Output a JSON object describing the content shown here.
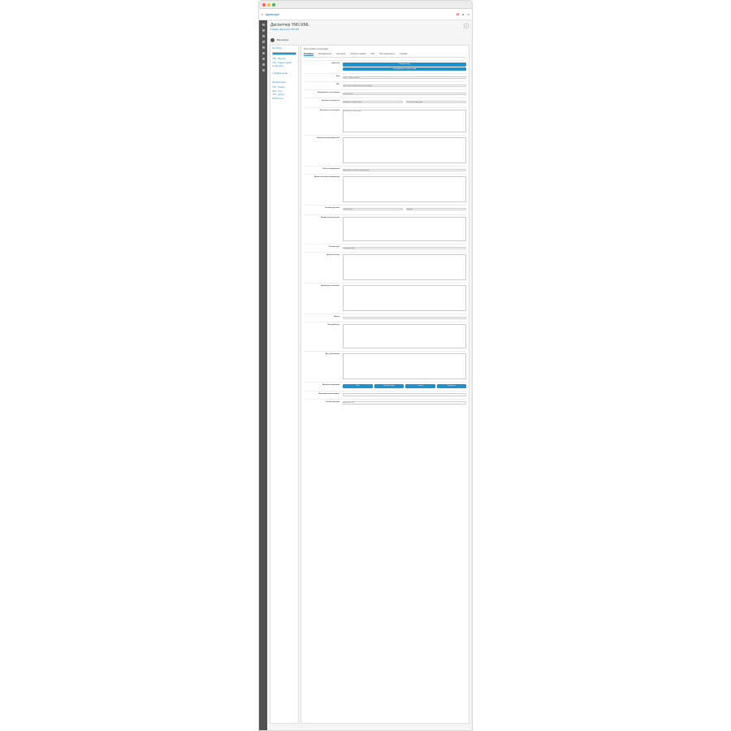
{
  "header": {
    "brand": "opencart",
    "badge": "3",
    "page_title": "Диспетчер YML\\XML",
    "breadcrumb": "Главная  /  Диспетчер YML\\XML"
  },
  "user": {
    "name": "Ваш аккаунт"
  },
  "left_panel": {
    "title": "Мои Фиды",
    "items": [
      {
        "label": "YML - Фид №1"
      },
      {
        "label": "YML - Яндекс маркет"
      },
      {
        "label": "Google фид"
      }
    ],
    "add_label": "+ Добавить фид",
    "docs_title": "Документация",
    "docs_items": [
      {
        "label": "YML - Яндекс"
      },
      {
        "label": "XML - Гугл"
      },
      {
        "label": "YML - другие"
      },
      {
        "label": "Обратиться"
      }
    ]
  },
  "right_panel": {
    "title": "Настройки генерации",
    "tabs": [
      {
        "label": "Основные"
      },
      {
        "label": "Производители"
      },
      {
        "label": "Категории"
      },
      {
        "label": "Атрибуты товаров"
      },
      {
        "label": "SEO"
      },
      {
        "label": "Мультиязычность"
      },
      {
        "label": "Справка"
      }
    ],
    "rows": [
      {
        "label": "Действия",
        "type": "buttons",
        "buttons": [
          "Получить Фид",
          "Сгенерировать ссылку на фид"
        ]
      },
      {
        "label": "Имя",
        "type": "input",
        "value": "YML - Яндекс маркет"
      },
      {
        "label": "URL",
        "type": "input",
        "value": "https://site.ru/index.php?route=feed/yml"
      },
      {
        "label": "Информация о поставщике",
        "type": "select",
        "value": "Из настроек"
      },
      {
        "label": "Доставка в продуктах",
        "type": "two-select",
        "value": "Выберите тип доставки",
        "value2": "Кол-во для доставки"
      },
      {
        "label": "Доставка по категориям",
        "type": "checklist",
        "value": "Выбрать все категории"
      },
      {
        "label": "Выгрузить производителей",
        "type": "box"
      },
      {
        "label": "Фото в изображения",
        "type": "select",
        "value": "Выгрузить основное изображение"
      },
      {
        "label": "Дополнительные изображения",
        "type": "box"
      },
      {
        "label": "Условия доставки",
        "type": "two-select",
        "value": "Самовывоз",
        "value2": "Курьер"
      },
      {
        "label": "Формула расчета цены",
        "type": "textarea",
        "value": ""
      },
      {
        "label": "Оптимизация",
        "type": "select",
        "value": "По умолчанию"
      },
      {
        "label": "Дополнительно",
        "type": "box"
      },
      {
        "label": "Параметры в описание",
        "type": "box"
      },
      {
        "label": "Формы",
        "type": "input",
        "value": ""
      },
      {
        "label": "Настройки цен",
        "type": "textarea",
        "value": ""
      },
      {
        "label": "Дата обновления",
        "type": "box"
      },
      {
        "label": "Выгрузить варианты",
        "type": "buttons4",
        "buttons": [
          "Фид",
          "Обновить фид",
          "Скачать",
          "Проверить"
        ]
      },
      {
        "label": "Пользовательский скрипт",
        "type": "input",
        "value": ""
      },
      {
        "label": "Способ выгрузки",
        "type": "select",
        "value": "Выгрузить все"
      }
    ]
  }
}
